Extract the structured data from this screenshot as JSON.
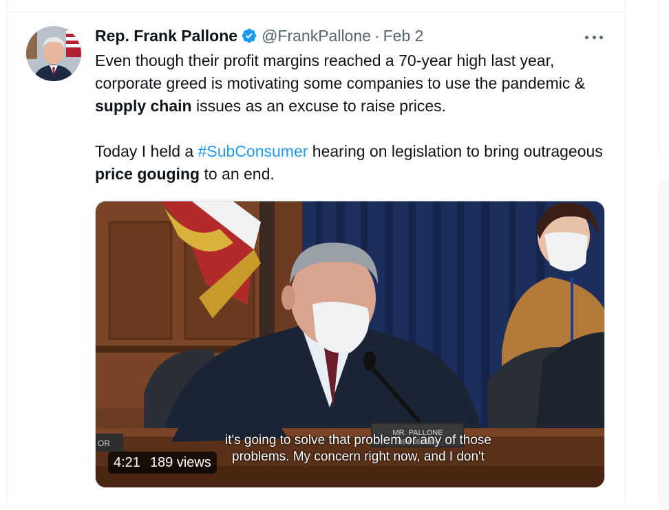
{
  "tweet": {
    "display_name": "Rep. Frank Pallone",
    "handle": "@FrankPallone",
    "separator": "·",
    "date": "Feb 2",
    "text_p1_a": "Even though their profit margins reached a 70-year high last year, corporate greed is motivating some companies to use the pandemic & ",
    "text_p1_bold": "supply chain",
    "text_p1_b": " issues as an excuse to raise prices.",
    "text_p2_a": "Today I held a ",
    "text_p2_hashtag": "#SubConsumer",
    "text_p2_b": " hearing on legislation to bring outrageous ",
    "text_p2_bold": "price gouging",
    "text_p2_c": " to an end.",
    "icons": {
      "avatar": "avatar-image",
      "verified": "verified-badge-icon",
      "more": "more-options-icon"
    }
  },
  "video": {
    "caption_line1": "it's going to solve that problem or any of those",
    "caption_line2": "problems. My concern right now, and I don't",
    "duration": "4:21",
    "views": "189 views",
    "nameplate": "MR. PALLONE",
    "nameplate_sub": "NEW JERSEY",
    "side_plate": "OR"
  },
  "colors": {
    "link": "#1d9bf0",
    "verified": "#1d9bf0",
    "secondary_text": "#536471",
    "primary_text": "#0f1419",
    "border": "#eff3f4"
  }
}
